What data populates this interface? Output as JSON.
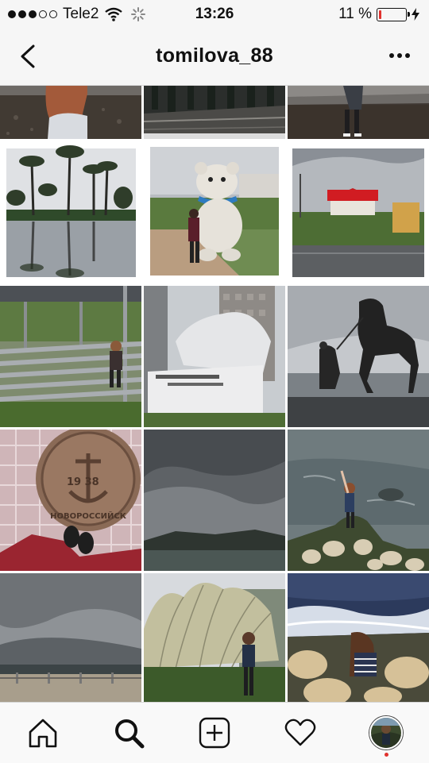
{
  "status_bar": {
    "carrier": "Tele2",
    "time": "13:26",
    "battery": "11 %",
    "battery_level": 0.11
  },
  "header": {
    "username": "tomilova_88",
    "back_icon": "chevron-left-icon",
    "menu_icon": "more-horizontal-icon"
  },
  "tab_bar": {
    "items": [
      "home-icon",
      "search-icon",
      "add-post-icon",
      "activity-heart-icon",
      "profile-avatar"
    ],
    "active": "search-icon",
    "notification_color": "#e0322e"
  },
  "grid": {
    "columns": 3,
    "photos": [
      "girl-on-pebble-beach",
      "empty-promenade",
      "girl-standing-on-beach",
      "palm-trees-reflection",
      "bear-mascot-statue",
      "red-roof-house",
      "girl-on-bleachers",
      "monument-relief",
      "horse-statue",
      "manhole-cover-anchor",
      "stormy-sea-clouds",
      "girl-on-rocks-waving",
      "cloudy-embankment",
      "girl-by-pampas-grass",
      "girl-on-sea-rocks"
    ],
    "manhole_text": "НОВОРОССИЙСК",
    "manhole_year": "19 38"
  },
  "colors": {
    "bar_background": "#f6f6f6",
    "text": "#111111",
    "accent_red": "#e0322e"
  }
}
